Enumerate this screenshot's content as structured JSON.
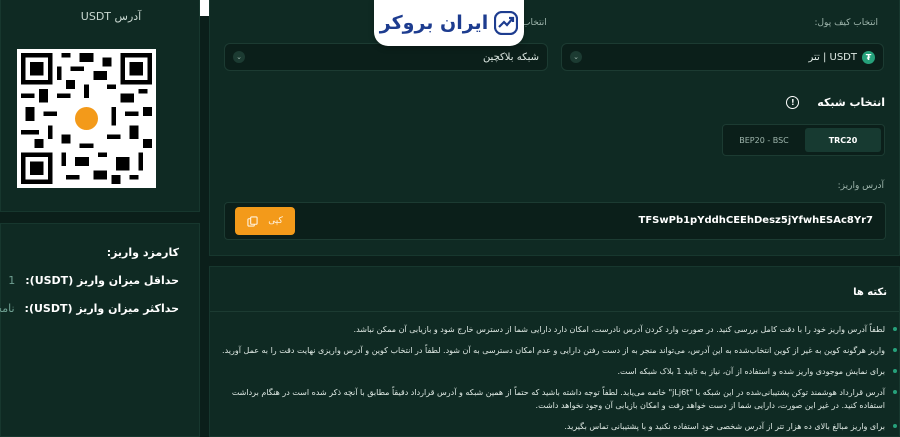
{
  "logo": {
    "text": "ایران بروکر"
  },
  "qr": {
    "title": "آدرس USDT"
  },
  "fees": {
    "title": "کارمزد واریز:",
    "min_label": "حداقل میزان واریز (USDT):",
    "min_value": "1",
    "max_label": "حداکثر میزان واریز (USDT):",
    "max_value": "نامحدود"
  },
  "wallet": {
    "wallet_label": "انتخاب کیف پول:",
    "network_select_label": "انتخاب",
    "coin_value": "USDT | تتر",
    "network_placeholder": "شبکه بلاکچین",
    "network_title": "انتخاب شبکه",
    "network_options": [
      "TRC20",
      "BEP20 - BSC"
    ],
    "address_label": "آدرس واریز:",
    "address": "TFSwPb1pYddhCEEhDesz5jYfwhESAc8Yr7",
    "copy_label": "کپی"
  },
  "notes": {
    "title": "نکته ها",
    "items": [
      "لطفاً آدرس واریز خود را با دقت کامل بررسی کنید. در صورت وارد کردن آدرس نادرست، امکان دارد دارایی شما از دسترس خارج شود و بازیابی آن ممکن نباشد.",
      "واریز هرگونه کوین به غیر از کوین انتخاب‌شده به این آدرس، می‌تواند منجر به از دست رفتن دارایی و عدم امکان دسترسی به آن شود. لطفاً در انتخاب کوین و آدرس واریزی نهایت دقت را به عمل آورید.",
      "برای نمایش موجودی واریز شده و استفاده از آن، نیاز به تایید 1 بلاک شبکه است.",
      "آدرس قرارداد هوشمند توکن پشتیبانی‌شده در این شبکه با \"jLj6t\" خاتمه می‌یابد. لطفاً توجه داشته باشید که حتماً از همین شبکه و آدرس قرارداد دقیقاً مطابق با آنچه ذکر شده است در هنگام برداشت استفاده کنید. در غیر این صورت، دارایی شما از دست خواهد رفت و امکان بازیابی آن وجود نخواهد داشت.",
      "برای واریز مبالغ بالای ده هزار تتر از آدرس شخصی خود استفاده نکنید و با پشتیبانی تماس بگیرید."
    ]
  }
}
